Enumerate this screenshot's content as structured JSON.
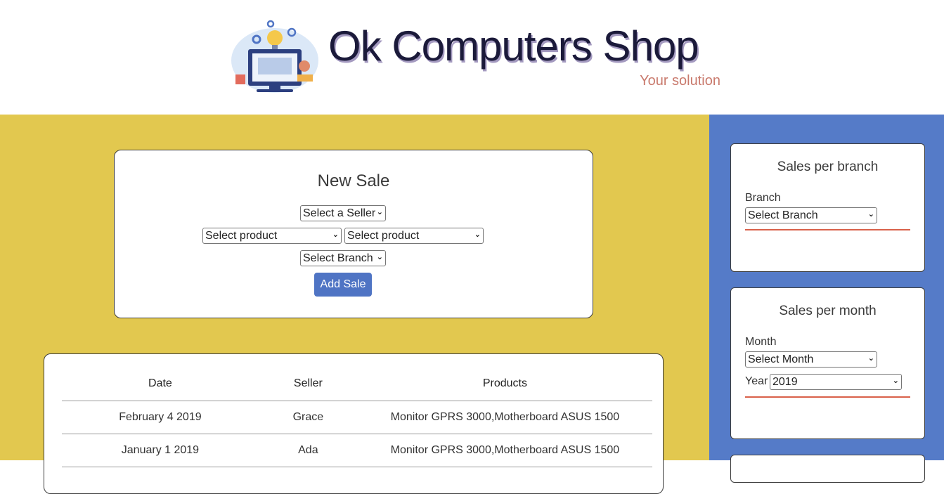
{
  "brand": {
    "title": "Ok Computers Shop",
    "subtitle": "Your solution"
  },
  "new_sale": {
    "heading": "New Sale",
    "seller_select": "Select a Seller",
    "product_select_1": "Select product",
    "product_select_2": "Select product",
    "branch_select": "Select Branch",
    "add_button": "Add Sale"
  },
  "sales_table": {
    "columns": [
      "Date",
      "Seller",
      "Products"
    ],
    "rows": [
      [
        "February 4 2019",
        "Grace",
        "Monitor GPRS 3000,Motherboard ASUS 1500"
      ],
      [
        "January 1 2019",
        "Ada",
        "Monitor GPRS 3000,Motherboard ASUS 1500"
      ]
    ]
  },
  "sidebar": {
    "branch_card": {
      "title": "Sales per branch",
      "label": "Branch",
      "select": "Select Branch"
    },
    "month_card": {
      "title": "Sales per month",
      "month_label": "Month",
      "month_select": "Select Month",
      "year_label": "Year",
      "year_select": "2019"
    }
  },
  "colors": {
    "main_bg": "#e2c84f",
    "sidebar_bg": "#557bc8",
    "button": "#4f74c4",
    "accent_line": "#d9614a",
    "subtitle": "#c97a6d"
  }
}
